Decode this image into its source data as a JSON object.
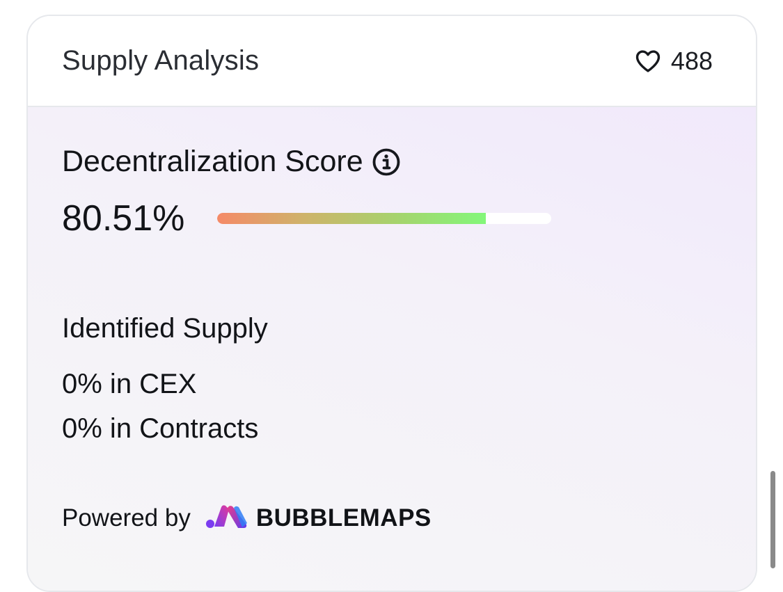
{
  "card": {
    "title": "Supply Analysis",
    "likes": {
      "icon": "heart-icon",
      "count": "488"
    }
  },
  "decentralization": {
    "title": "Decentralization Score",
    "info_icon": "info-icon",
    "value_text": "80.51%",
    "progress_fraction": 0.8051,
    "gradient_colors": [
      "#f58a68",
      "#cdb46a",
      "#a6d36d",
      "#83f77a"
    ]
  },
  "identified_supply": {
    "title": "Identified Supply",
    "cex": "0% in CEX",
    "contracts": "0% in Contracts"
  },
  "footer": {
    "powered_by": "Powered by",
    "brand_icon": "bubblemaps-logo-icon",
    "brand_name": "BUBBLEMAPS"
  }
}
